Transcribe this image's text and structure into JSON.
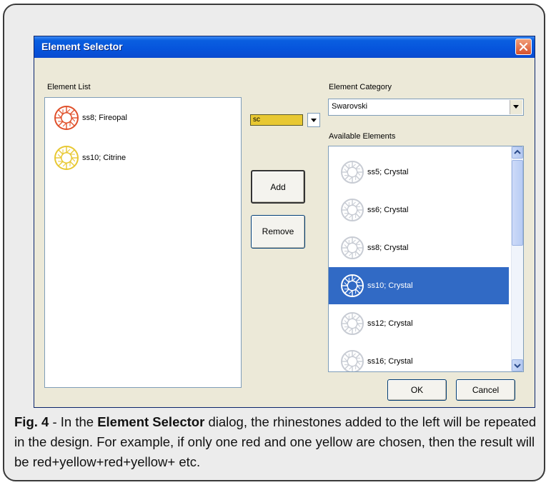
{
  "dialog": {
    "title": "Element Selector",
    "element_list_label": "Element List",
    "element_category_label": "Element Category",
    "available_elements_label": "Available Elements",
    "element_list": [
      {
        "label": "ss8; Fireopal",
        "color": "#e0502a"
      },
      {
        "label": "ss10; Citrine",
        "color": "#e8c832"
      }
    ],
    "color_selector": {
      "value": "sc",
      "swatch_color": "#e8c832"
    },
    "category": {
      "selected": "Swarovski"
    },
    "available_elements": [
      {
        "label": "ss5; Crystal",
        "selected": false
      },
      {
        "label": "ss6; Crystal",
        "selected": false
      },
      {
        "label": "ss8; Crystal",
        "selected": false
      },
      {
        "label": "ss10; Crystal",
        "selected": true
      },
      {
        "label": "ss12; Crystal",
        "selected": false
      },
      {
        "label": "ss16; Crystal",
        "selected": false
      }
    ],
    "buttons": {
      "add": "Add",
      "remove": "Remove",
      "ok": "OK",
      "cancel": "Cancel"
    }
  },
  "caption": {
    "fig": "Fig. 4",
    "pre": " - In the ",
    "bold": "Element Selector",
    "post": " dialog, the rhinestones added to the left will be repeated in the design. For example, if only one red and one yellow are chosen, then the result will be red+yellow+red+yellow+ etc."
  },
  "colors": {
    "titlebar": "#0654dc",
    "selection": "#316ac5",
    "crystal_stroke": "#c8ccd4"
  }
}
